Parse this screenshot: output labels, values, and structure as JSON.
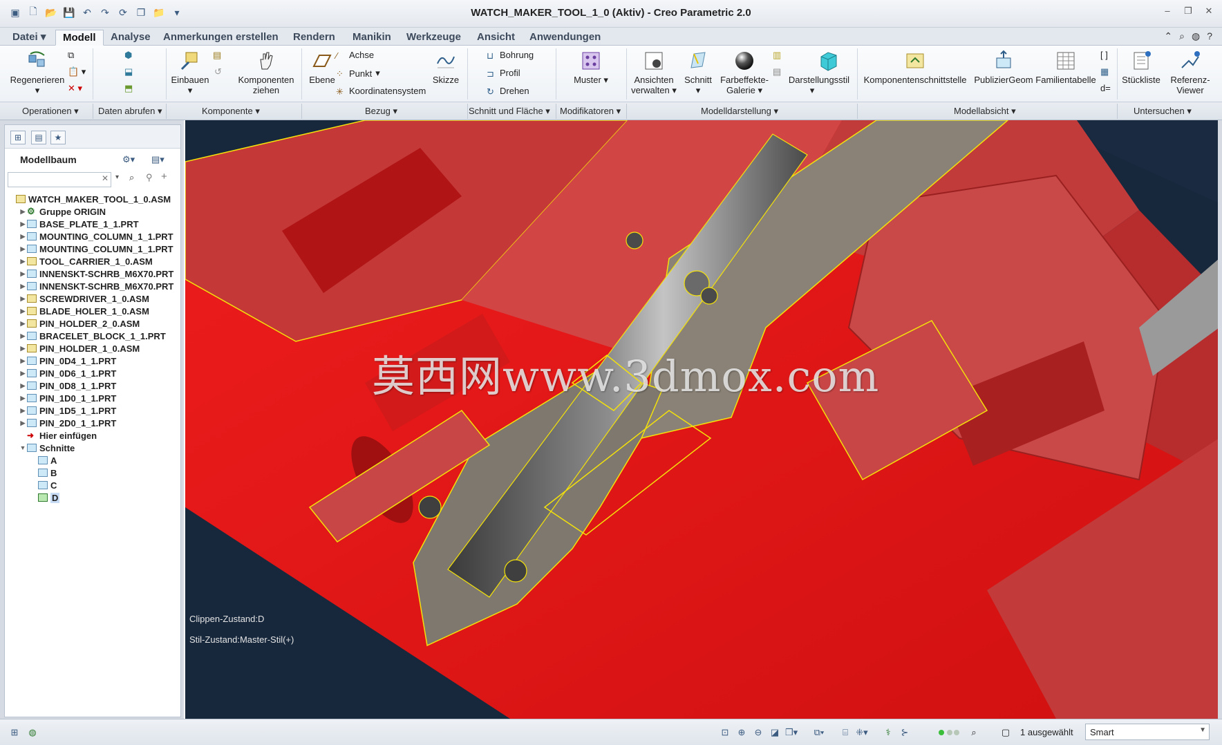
{
  "window": {
    "title": "WATCH_MAKER_TOOL_1_0 (Aktiv) - Creo Parametric 2.0"
  },
  "tabs": [
    {
      "label": "Datei",
      "has_dropdown": true
    },
    {
      "label": "Modell",
      "active": true
    },
    {
      "label": "Analyse"
    },
    {
      "label": "Anmerkungen erstellen"
    },
    {
      "label": "Rendern"
    },
    {
      "label": "Manikin"
    },
    {
      "label": "Werkzeuge"
    },
    {
      "label": "Ansicht"
    },
    {
      "label": "Anwendungen"
    }
  ],
  "ribbon": {
    "regenerieren": "Regenerieren",
    "einbauen": "Einbauen",
    "komponenten_ziehen": "Komponenten ziehen",
    "ebene": "Ebene",
    "achse": "Achse",
    "punkt": "Punkt",
    "koordinatensystem": "Koordinatensystem",
    "skizze": "Skizze",
    "bohrung": "Bohrung",
    "profil": "Profil",
    "drehen": "Drehen",
    "muster": "Muster",
    "ansichten_verwalten": "Ansichten verwalten",
    "schnitt": "Schnitt",
    "farbeffekte_galerie": "Farbeffekte-Galerie",
    "darstellungsstil": "Darstellungsstil",
    "komponentenschnittstelle": "Komponentenschnittstelle",
    "publiziergeom": "PublizierGeom",
    "familientabelle": "Familientabelle",
    "stueckliste": "Stückliste",
    "referenz_viewer": "Referenz-Viewer"
  },
  "groups": [
    {
      "label": "Operationen"
    },
    {
      "label": "Daten abrufen"
    },
    {
      "label": "Komponente"
    },
    {
      "label": "Bezug"
    },
    {
      "label": "Schnitt und Fläche"
    },
    {
      "label": "Modifikatoren"
    },
    {
      "label": "Modelldarstellung"
    },
    {
      "label": "Modellabsicht"
    },
    {
      "label": "Untersuchen"
    }
  ],
  "left_panel": {
    "title": "Modellbaum",
    "search_placeholder": ""
  },
  "tree": [
    {
      "label": "WATCH_MAKER_TOOL_1_0.ASM",
      "level": 0,
      "icon": "assembly-icon"
    },
    {
      "label": "Gruppe ORIGIN",
      "level": 1,
      "icon": "group-icon"
    },
    {
      "label": "BASE_PLATE_1_1.PRT",
      "level": 1,
      "icon": "part-icon"
    },
    {
      "label": "MOUNTING_COLUMN_1_1.PRT",
      "level": 1,
      "icon": "part-icon"
    },
    {
      "label": "MOUNTING_COLUMN_1_1.PRT",
      "level": 1,
      "icon": "part-icon"
    },
    {
      "label": "TOOL_CARRIER_1_0.ASM",
      "level": 1,
      "icon": "assembly-icon"
    },
    {
      "label": "INNENSKT-SCHRB_M6X70.PRT",
      "level": 1,
      "icon": "part-icon"
    },
    {
      "label": "INNENSKT-SCHRB_M6X70.PRT",
      "level": 1,
      "icon": "part-icon"
    },
    {
      "label": "SCREWDRIVER_1_0.ASM",
      "level": 1,
      "icon": "assembly-icon"
    },
    {
      "label": "BLADE_HOLER_1_0.ASM",
      "level": 1,
      "icon": "assembly-icon"
    },
    {
      "label": "PIN_HOLDER_2_0.ASM",
      "level": 1,
      "icon": "assembly-icon"
    },
    {
      "label": "BRACELET_BLOCK_1_1.PRT",
      "level": 1,
      "icon": "part-icon"
    },
    {
      "label": "PIN_HOLDER_1_0.ASM",
      "level": 1,
      "icon": "assembly-icon"
    },
    {
      "label": "PIN_0D4_1_1.PRT",
      "level": 1,
      "icon": "part-icon"
    },
    {
      "label": "PIN_0D6_1_1.PRT",
      "level": 1,
      "icon": "part-icon"
    },
    {
      "label": "PIN_0D8_1_1.PRT",
      "level": 1,
      "icon": "part-icon"
    },
    {
      "label": "PIN_1D0_1_1.PRT",
      "level": 1,
      "icon": "part-icon"
    },
    {
      "label": "PIN_1D5_1_1.PRT",
      "level": 1,
      "icon": "part-icon"
    },
    {
      "label": "PIN_2D0_1_1.PRT",
      "level": 1,
      "icon": "part-icon"
    },
    {
      "label": "Hier einfügen",
      "level": 1,
      "icon": "insert-arrow-icon"
    },
    {
      "label": "Schnitte",
      "level": 1,
      "icon": "sections-icon",
      "expanded": true
    },
    {
      "label": "A",
      "level": 2,
      "icon": "section-icon"
    },
    {
      "label": "B",
      "level": 2,
      "icon": "section-icon"
    },
    {
      "label": "C",
      "level": 2,
      "icon": "section-icon"
    },
    {
      "label": "D",
      "level": 2,
      "icon": "section-active-icon",
      "selected": true
    }
  ],
  "viewport": {
    "clip_state": "Clippen-Zustand:D",
    "style_state": "Stil-Zustand:Master-Stil(+)",
    "watermark": "莫西网www.3dmox.com",
    "colors": {
      "background": "#17283d",
      "red_part": "#e61b1b",
      "red_face": "#c84646",
      "steel": "#8a8276",
      "highlight": "#f4e20a"
    }
  },
  "statusbar": {
    "selection": "1 ausgewählt",
    "filter_value": "Smart"
  }
}
